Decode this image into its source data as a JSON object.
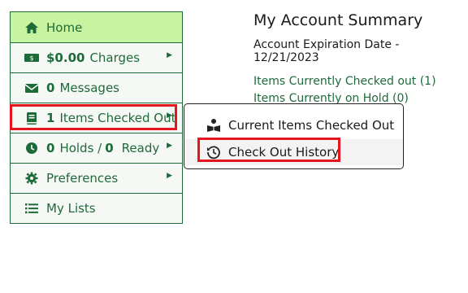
{
  "sidebar": {
    "items": [
      {
        "label": "Home",
        "icon": "home-icon"
      },
      {
        "number": "$0.00",
        "label": "Charges",
        "icon": "money-icon"
      },
      {
        "number": "0",
        "label": "Messages",
        "icon": "envelope-icon"
      },
      {
        "number": "1",
        "label": "Items Checked Out",
        "icon": "book-icon"
      },
      {
        "number": "0",
        "label_pre": "Holds /",
        "number2": "0",
        "label": "Ready",
        "icon": "clock-icon"
      },
      {
        "label": "Preferences",
        "icon": "gear-icon"
      },
      {
        "label": "My Lists",
        "icon": "list-icon"
      }
    ]
  },
  "main": {
    "title": "My Account Summary",
    "expiration": "Account Expiration Date - 12/21/2023",
    "links": [
      "Items Currently Checked out (1)",
      "Items Currently on Hold (0)"
    ]
  },
  "dropdown": {
    "items": [
      {
        "label": "Current Items Checked Out",
        "icon": "reader-icon"
      },
      {
        "label": "Check Out History",
        "icon": "history-icon"
      }
    ]
  },
  "colors": {
    "accent": "#1e6b3a",
    "home_bg": "#c8f3a0",
    "highlight": "#e3151d"
  }
}
